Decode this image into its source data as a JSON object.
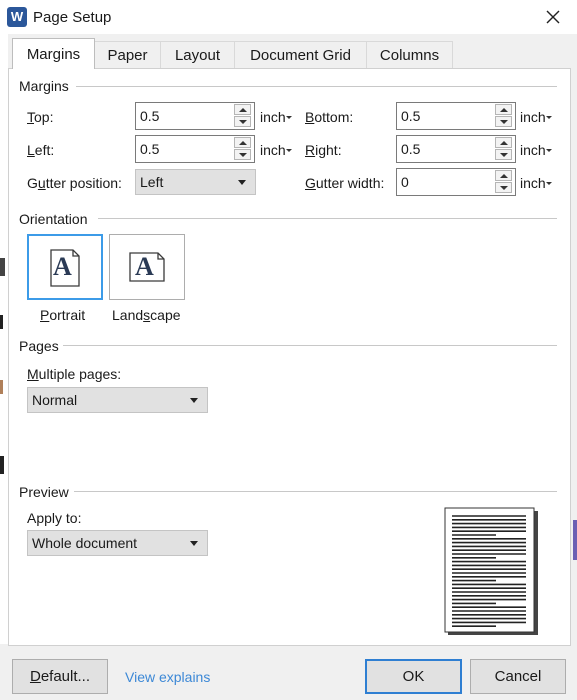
{
  "window": {
    "app_icon_letter": "W",
    "title": "Page Setup"
  },
  "tabs": [
    {
      "label": "Margins",
      "active": true
    },
    {
      "label": "Paper"
    },
    {
      "label": "Layout"
    },
    {
      "label": "Document Grid"
    },
    {
      "label": "Columns"
    }
  ],
  "margins": {
    "section_title": "Margins",
    "top": {
      "label_key": "T",
      "label_rest": "op:",
      "value": "0.5",
      "unit": "inch"
    },
    "bottom": {
      "label_key": "B",
      "label_rest": "ottom:",
      "value": "0.5",
      "unit": "inch"
    },
    "left": {
      "label_key": "L",
      "label_rest": "eft:",
      "value": "0.5",
      "unit": "inch"
    },
    "right": {
      "label_key": "R",
      "label_rest": "ight:",
      "value": "0.5",
      "unit": "inch"
    },
    "gutter_position": {
      "label_pre": "G",
      "label_key": "u",
      "label_rest": "tter position:",
      "value": "Left"
    },
    "gutter_width": {
      "label_key": "G",
      "label_rest": "utter width:",
      "value": "0",
      "unit": "inch"
    }
  },
  "orientation": {
    "section_title": "Orientation",
    "glyph": "A",
    "portrait": {
      "label_key": "P",
      "label_rest": "ortrait",
      "selected": true
    },
    "landscape": {
      "label_pre": "Land",
      "label_key": "s",
      "label_rest": "cape",
      "selected": false
    }
  },
  "pages": {
    "section_title": "Pages",
    "multiple_pages": {
      "label_key": "M",
      "label_rest": "ultiple pages:",
      "value": "Normal"
    }
  },
  "preview": {
    "section_title": "Preview",
    "apply_to": {
      "label_key": "",
      "label_rest": "Apply to:",
      "value": "Whole document"
    }
  },
  "buttons": {
    "default": {
      "label_key": "D",
      "label_rest": "efault..."
    },
    "view_explains": "View explains",
    "ok": "OK",
    "cancel": "Cancel"
  },
  "colors": {
    "accent": "#3c9be8",
    "link": "#3c88d6",
    "app_icon": "#2b579a"
  }
}
